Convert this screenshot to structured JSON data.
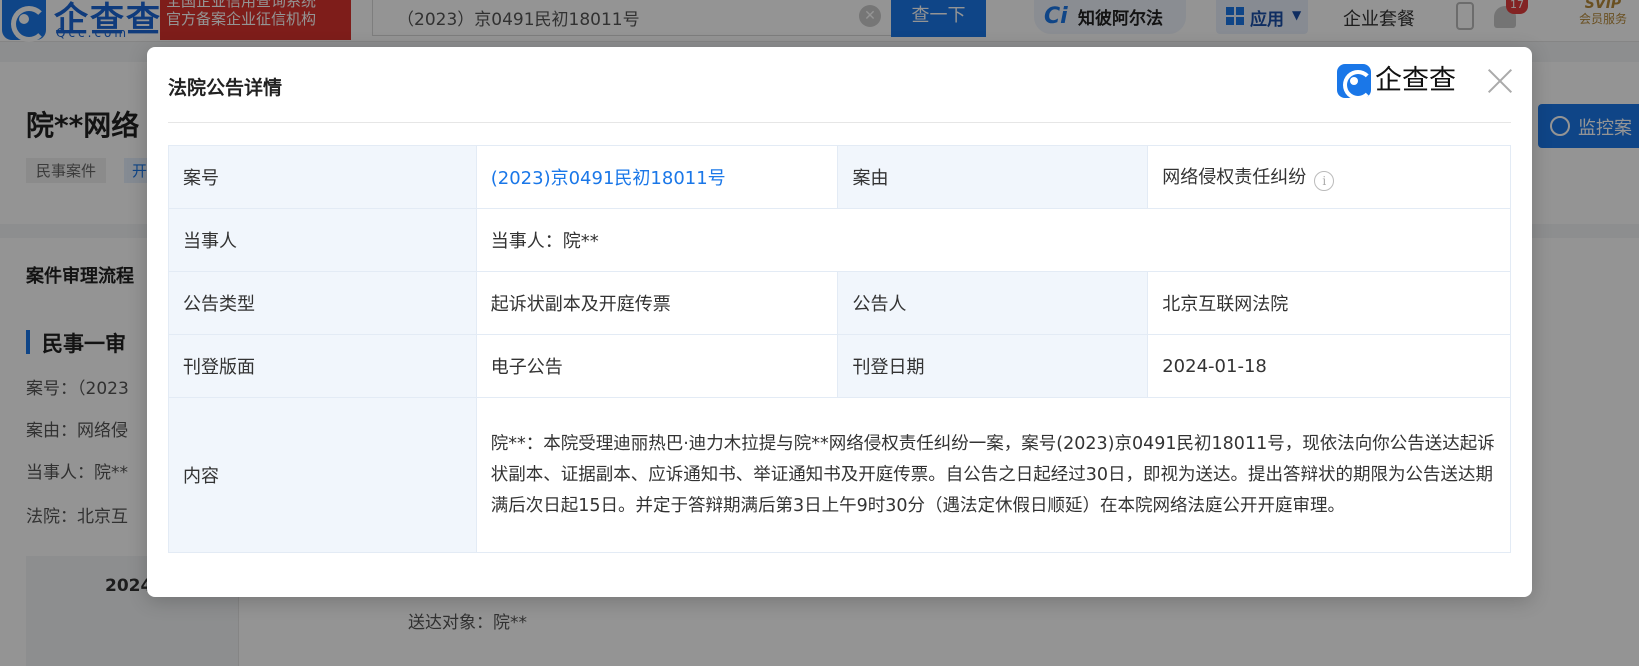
{
  "header": {
    "logo_text": "企查查",
    "logo_sub": "Qcc.com",
    "cert_line1": "全国企业信用查询系统",
    "cert_line2": "官方备案企业征信机构",
    "search_value": "（2023）京0491民初18011号",
    "search_button": "查一下",
    "ai_label": "知彼阿尔法",
    "apps_label": "应用",
    "package_label": "企业套餐",
    "notification_count": "17",
    "svip_title": "SVIP",
    "svip_sub": "会员服务"
  },
  "background": {
    "company_title": "院**网络",
    "tag_case_type": "民事案件",
    "tag_status": "开",
    "monitor_button": "监控案",
    "flow_title": "案件审理流程",
    "stage_title": "民事一审",
    "line_case_no": "案号：（2023",
    "line_cause": "案由：网络侵",
    "line_party": "当事人：院**",
    "line_court": "法院：北京互",
    "date_partial": "2024",
    "delivery_target": "送达对象：院**"
  },
  "modal": {
    "title": "法院公告详情",
    "brand": "企查查",
    "rows": {
      "case_no_label": "案号",
      "case_no_value": "(2023)京0491民初18011号",
      "cause_label": "案由",
      "cause_value": "网络侵权责任纠纷",
      "party_label": "当事人",
      "party_value": "当事人：院**",
      "notice_type_label": "公告类型",
      "notice_type_value": "起诉状副本及开庭传票",
      "announcer_label": "公告人",
      "announcer_value": "北京互联网法院",
      "publish_section_label": "刊登版面",
      "publish_section_value": "电子公告",
      "publish_date_label": "刊登日期",
      "publish_date_value": "2024-01-18",
      "content_label": "内容",
      "content_value": "院**：本院受理迪丽热巴·迪力木拉提与院**网络侵权责任纠纷一案，案号(2023)京0491民初18011号，现依法向你公告送达起诉状副本、证据副本、应诉通知书、举证通知书及开庭传票。自公告之日起经过30日，即视为送达。提出答辩状的期限为公告送达期满后次日起15日。并定于答辩期满后第3日上午9时30分（遇法定休假日顺延）在本院网络法庭公开开庭审理。"
    }
  },
  "colors": {
    "accent": "#1a77e8",
    "cert_red": "#d9322d",
    "label_bg": "#f1f6fc"
  },
  "icons": [
    "logo-mark-icon",
    "clear-icon",
    "ai-logo-icon",
    "apps-grid-icon",
    "phone-icon",
    "bell-icon",
    "monitor-icon",
    "brand-mark-icon",
    "close-icon",
    "info-icon"
  ]
}
